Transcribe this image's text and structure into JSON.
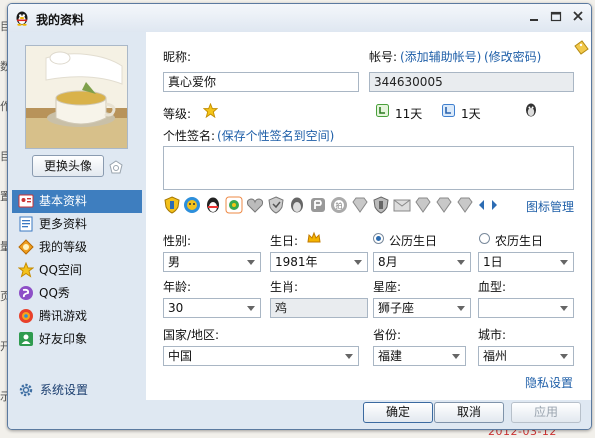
{
  "window": {
    "title": "我的资料"
  },
  "background": {
    "date_text": "2012-03-12",
    "edge_chars": [
      "目",
      "数",
      "作",
      "目",
      "置",
      "量",
      "页",
      "开",
      "示"
    ]
  },
  "sidebar": {
    "change_avatar_label": "更换头像",
    "items": [
      {
        "label": "基本资料",
        "icon": "profile-card-icon"
      },
      {
        "label": "更多资料",
        "icon": "more-info-icon"
      },
      {
        "label": "我的等级",
        "icon": "level-icon"
      },
      {
        "label": "QQ空间",
        "icon": "qzone-icon"
      },
      {
        "label": "QQ秀",
        "icon": "qqshow-icon"
      },
      {
        "label": "腾讯游戏",
        "icon": "games-icon"
      },
      {
        "label": "好友印象",
        "icon": "impression-icon"
      }
    ],
    "system_settings_label": "系统设置"
  },
  "profile": {
    "nickname_label": "昵称:",
    "nickname_value": "真心爱你",
    "account_label": "帐号:",
    "add_helper_account_link": "(添加辅助帐号)",
    "change_password_link": "(修改密码)",
    "account_value": "344630005",
    "level_label": "等级:",
    "online_days_1": "11天",
    "online_days_2": "1天",
    "signature_label": "个性签名:",
    "save_signature_link": "(保存个性签名到空间)",
    "icon_manage_link": "图标管理"
  },
  "details": {
    "gender_label": "性别:",
    "gender_value": "男",
    "birthday_label": "生日:",
    "solar_birthday_label": "公历生日",
    "lunar_birthday_label": "农历生日",
    "year_value": "1981年",
    "month_value": "8月",
    "day_value": "1日",
    "age_label": "年龄:",
    "age_value": "30",
    "zodiac_label": "生肖:",
    "zodiac_value": "鸡",
    "star_label": "星座:",
    "star_value": "狮子座",
    "blood_label": "血型:",
    "blood_value": "",
    "country_label": "国家/地区:",
    "country_value": "中国",
    "province_label": "省份:",
    "province_value": "福建",
    "city_label": "城市:",
    "city_value": "福州",
    "privacy_link": "隐私设置"
  },
  "footer": {
    "ok_label": "确定",
    "cancel_label": "取消",
    "apply_label": "应用"
  },
  "colors": {
    "accent": "#3e7ebf",
    "link": "#1f5fa8",
    "window_bg": "#dfe8f2"
  }
}
